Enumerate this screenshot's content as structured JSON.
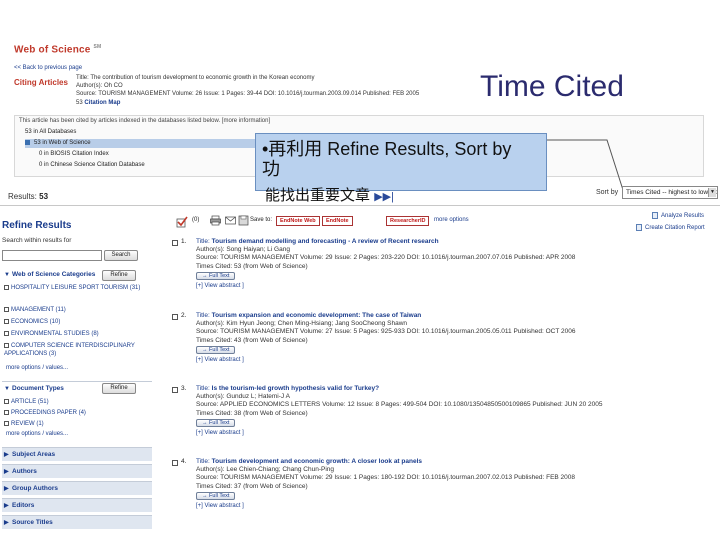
{
  "heading": "Time Cited",
  "wos": {
    "logo": "Web of Science",
    "logo_mark": "SM",
    "back_link": "<< Back to previous page"
  },
  "citing": {
    "label": "Citing Articles",
    "title": "Title: The contribution of tourism development to economic growth in the Korean economy",
    "authors": "Author(s): Oh CO",
    "source": "Source: TOURISM MANAGEMENT  Volume: 26  Issue: 1  Pages: 39-44  DOI: 10.1016/j.tourman.2003.09.014  Published: FEB 2005",
    "citation_map_count": "53",
    "citation_map": "Citation Map"
  },
  "databases": {
    "note": "This article has been cited by articles indexed in the databases listed below. [more information]",
    "rows": [
      "53 in All Databases",
      "53 in Web of Science",
      "0 in BIOSIS Citation Index",
      "0 in Chinese Science Citation Database"
    ]
  },
  "callout": {
    "line1": "•再利用 Refine Results, Sort by",
    "line2": "功",
    "line3": "能找出重要文章"
  },
  "results": {
    "label": "Results:",
    "count": "53"
  },
  "sort": {
    "label": "Sort by",
    "value": "Times Cited -- highest to lowest"
  },
  "refine": {
    "title": "Refine Results",
    "search_label": "Search within results for",
    "search_button": "Search",
    "refine_button": "Refine",
    "more_options": "more options / values...",
    "categories": {
      "head": "Web of Science Categories",
      "items": [
        "HOSPITALITY LEISURE SPORT TOURISM (31)",
        "MANAGEMENT (11)",
        "ECONOMICS (10)",
        "ENVIRONMENTAL STUDIES (8)",
        "COMPUTER SCIENCE INTERDISCIPLINARY APPLICATIONS (3)"
      ]
    },
    "doctypes": {
      "head": "Document Types",
      "items": [
        "ARTICLE (51)",
        "PROCEEDINGS PAPER (4)",
        "REVIEW (1)"
      ]
    },
    "collapsed": [
      "Subject Areas",
      "Authors",
      "Group Authors",
      "Editors",
      "Source Titles"
    ]
  },
  "toolbar": {
    "count": "(0)",
    "save_to": "Save to:",
    "endnote_web": "EndNote Web",
    "endnote": "EndNote",
    "researcherid": "ResearcherID",
    "more_options": "more options",
    "analyze": "Analyze Results",
    "citation_report": "Create Citation Report"
  },
  "records": [
    {
      "num": "1.",
      "title_prefix": "Title:",
      "title": "Tourism demand modelling and forecasting - A review of Recent research",
      "authors": "Author(s): Song Haiyan; Li Gang",
      "source": "Source: TOURISM MANAGEMENT  Volume: 29  Issue: 2  Pages: 203-220  DOI: 10.1016/j.tourman.2007.07.016  Published: APR 2008",
      "times": "Times Cited: 53 (from Web of Science)",
      "fulltext": "→ Full Text",
      "abstract": "[+] View abstract ]"
    },
    {
      "num": "2.",
      "title_prefix": "Title:",
      "title": "Tourism expansion and economic development: The case of Taiwan",
      "authors": "Author(s): Kim Hyun Jeong; Chen Ming-Hsiang; Jang SooCheong Shawn",
      "source": "Source: TOURISM MANAGEMENT  Volume: 27  Issue: 5  Pages: 925-933  DOI: 10.1016/j.tourman.2005.05.011  Published: OCT 2006",
      "times": "Times Cited: 43 (from Web of Science)",
      "fulltext": "→ Full Text",
      "abstract": "[+] View abstract ]"
    },
    {
      "num": "3.",
      "title_prefix": "Title:",
      "title": "Is the tourism-led growth hypothesis valid for Turkey?",
      "authors": "Author(s): Gunduz L; Hatemi-J A",
      "source": "Source: APPLIED ECONOMICS LETTERS  Volume: 12  Issue: 8  Pages: 499-504  DOI: 10.1080/13504850500109865  Published: JUN 20 2005",
      "times": "Times Cited: 38 (from Web of Science)",
      "fulltext": "→ Full Text",
      "abstract": "[+] View abstract ]"
    },
    {
      "num": "4.",
      "title_prefix": "Title:",
      "title": "Tourism development and economic growth: A closer look at panels",
      "authors": "Author(s): Lee Chien-Chiang; Chang Chun-Ping",
      "source": "Source: TOURISM MANAGEMENT  Volume: 29  Issue: 1  Pages: 180-192  DOI: 10.1016/j.tourman.2007.02.013  Published: FEB 2008",
      "times": "Times Cited: 37 (from Web of Science)",
      "fulltext": "→ Full Text",
      "abstract": "[+] View abstract ]"
    }
  ]
}
